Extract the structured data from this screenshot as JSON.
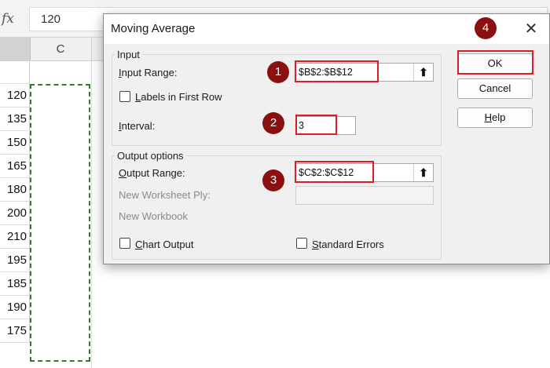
{
  "formula_bar": {
    "fx_label": "fx",
    "value": "120"
  },
  "columns": {
    "c_label": "C"
  },
  "column_b_values": [
    "120",
    "135",
    "150",
    "165",
    "180",
    "200",
    "210",
    "195",
    "185",
    "190",
    "175"
  ],
  "dialog": {
    "title": "Moving Average",
    "close_glyph": "✕",
    "input_group": {
      "label": "Input",
      "input_range_label": "Input Range:",
      "input_range_value": "$B$2:$B$12",
      "labels_first_row_label": "Labels in First Row",
      "interval_label": "Interval:",
      "interval_value": "3"
    },
    "output_group": {
      "label": "Output options",
      "output_range_label": "Output Range:",
      "output_range_value": "$C$2:$C$12",
      "new_worksheet_label": "New Worksheet Ply:",
      "new_workbook_label": "New Workbook",
      "chart_output_label": "Chart Output",
      "standard_errors_label": "Standard Errors"
    },
    "buttons": {
      "ok": "OK",
      "cancel": "Cancel",
      "help": "Help"
    },
    "ref_glyph": "⬆"
  },
  "badges": [
    "1",
    "2",
    "3",
    "4"
  ],
  "colors": {
    "highlight": "#e01b24",
    "badge": "#8b1010",
    "marquee": "#2e7d32"
  }
}
